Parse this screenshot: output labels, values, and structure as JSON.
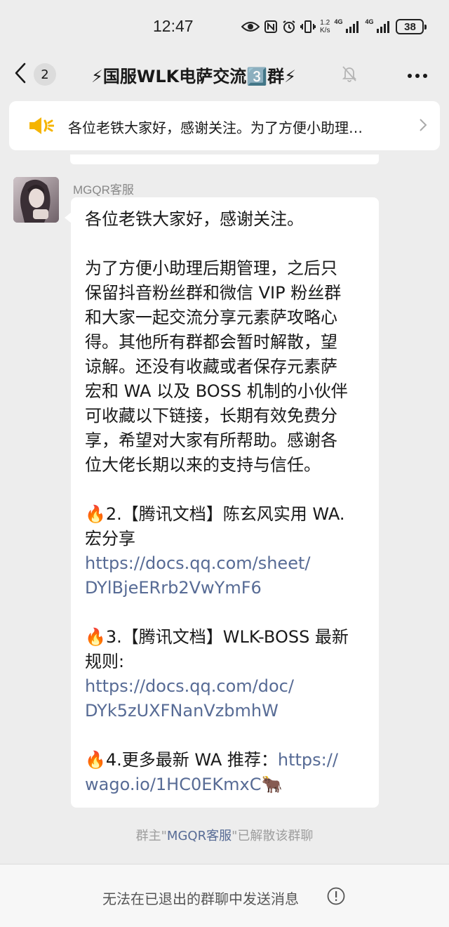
{
  "status_bar": {
    "time": "12:47",
    "speed_value": "1.2",
    "speed_unit": "K/s",
    "net1": "4G",
    "net2": "4G",
    "battery": "38"
  },
  "nav": {
    "unread_count": "2",
    "title": "⚡国服WLK电萨交流3️⃣群⚡"
  },
  "pinned": {
    "text": "各位老铁大家好，感谢关注。为了方便小助理…"
  },
  "message": {
    "sender": "MGQR客服",
    "lines": [
      "各位老铁大家好，感谢关注。",
      "",
      "为了方便小助理后期管理，之后只",
      "保留抖音粉丝群和微信 VIP 粉丝群",
      "和大家一起交流分享元素萨攻略心",
      "得。其他所有群都会暂时解散，望",
      "谅解。还没有收藏或者保存元素萨",
      "宏和 WA 以及 BOSS 机制的小伙伴",
      "可收藏以下链接，长期有效免费分",
      "享，希望对大家有所帮助。感谢各",
      "位大佬长期以来的支持与信任。",
      "",
      "🔥2.【腾讯文档】陈玄风实用 WA.",
      "宏分享",
      "",
      "",
      "",
      "🔥3.【腾讯文档】WLK-BOSS 最新",
      "规则:",
      "",
      "",
      "",
      "",
      ""
    ],
    "link1_line1": "https://docs.qq.com/sheet/",
    "link1_line2": "DYlBjeERrb2VwYmF6",
    "link2_line1": "https://docs.qq.com/doc/",
    "link2_line2": "DYk5zUXFNanVzbmhW",
    "item4_prefix": "🔥4.更多最新 WA 推荐：",
    "link3_part1": "https://",
    "link3_part2": "wago.io/1HC0EKmxC",
    "item4_suffix": "🐂"
  },
  "system_notice": {
    "prefix": "群主\"",
    "name": "MGQR客服",
    "suffix": "\"已解散该群聊"
  },
  "bottom_bar": {
    "text": "无法在已退出的群聊中发送消息"
  },
  "icons": {
    "back": "chevron-left-icon",
    "mute": "bell-off-icon",
    "more": "more-dots-icon",
    "speaker": "speaker-icon",
    "info": "info-circle-icon"
  },
  "colors": {
    "background": "#ededed",
    "bubble": "#ffffff",
    "link": "#576b95",
    "speaker": "#f5b400"
  }
}
